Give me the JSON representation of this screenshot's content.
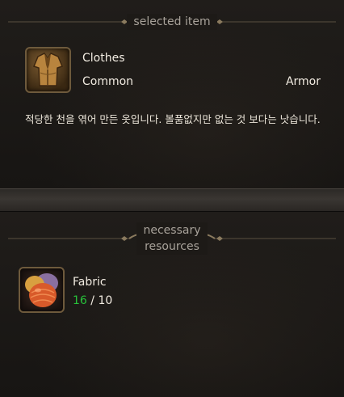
{
  "selected_section": {
    "header": "selected item",
    "item": {
      "name": "Clothes",
      "rarity": "Common",
      "type": "Armor",
      "icon": "clothes-icon",
      "description": "적당한 천을 엮어 만든 옷입니다. 볼품없지만 없는 것 보다는 낫습니다."
    }
  },
  "resources_section": {
    "header_line1": "necessary",
    "header_line2": "resources",
    "resources": [
      {
        "name": "Fabric",
        "icon": "fabric-icon",
        "have": "16",
        "separator": " / ",
        "need": "10"
      }
    ]
  },
  "colors": {
    "have_ok": "#27c23a",
    "ornament": "#8a7a5e",
    "icon_border": "#6e5a3c"
  }
}
